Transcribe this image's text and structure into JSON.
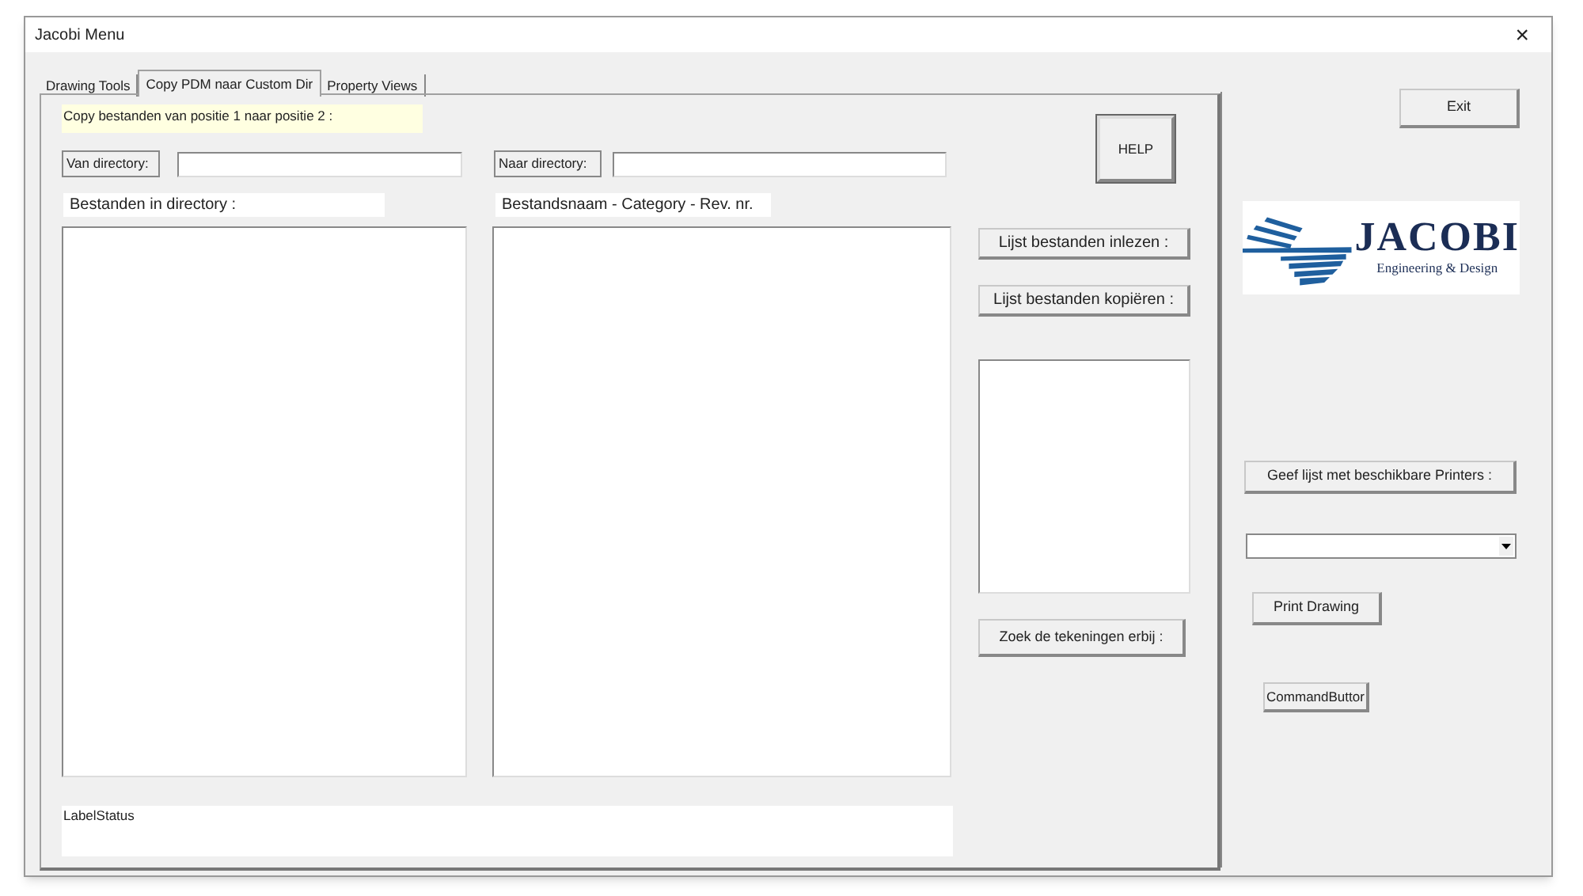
{
  "window": {
    "title": "Jacobi Menu",
    "close": "×"
  },
  "tabs": [
    {
      "label": "Drawing Tools",
      "selected": false
    },
    {
      "label": "Copy PDM naar Custom Dir",
      "selected": true
    },
    {
      "label": "Property Views",
      "selected": false
    }
  ],
  "panel": {
    "note": "Copy bestanden van positie 1 naar positie 2  :",
    "from_label": "Van directory:",
    "to_label": "Naar directory:",
    "list_left_label": "Bestanden in directory :",
    "list_right_label": "Bestandsnaam - Category - Rev. nr.",
    "help_button": "HELP",
    "read_button": "Lijst bestanden inlezen :",
    "copy_button": "Lijst bestanden kopiëren :",
    "find_button": "Zoek de tekeningen erbij :",
    "status_label": "LabelStatus"
  },
  "side": {
    "exit_button": "Exit",
    "logo": {
      "name": "JACOBI",
      "tagline": "Engineering & Design"
    },
    "printers_button": "Geef lijst met beschikbare Printers :",
    "print_button": "Print Drawing",
    "command_button": "CommandButtor"
  }
}
